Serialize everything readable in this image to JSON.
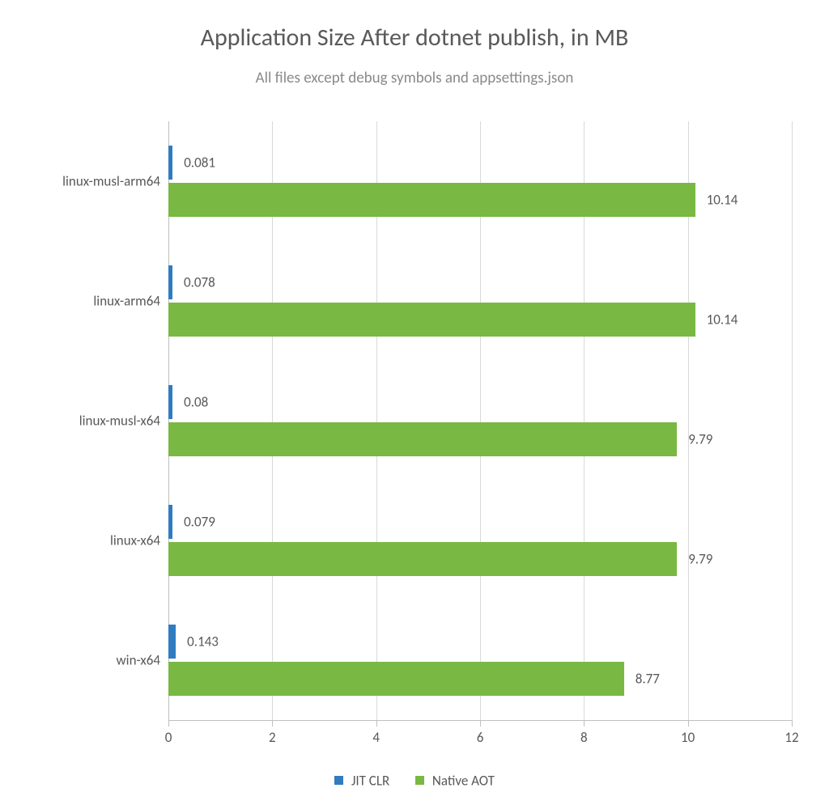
{
  "chart_data": {
    "type": "bar",
    "orientation": "horizontal",
    "title": "Application Size After dotnet publish, in MB",
    "subtitle": "All files except debug symbols and appsettings.json",
    "xlabel": "",
    "ylabel": "",
    "xlim": [
      0,
      12
    ],
    "x_ticks": [
      0,
      2,
      4,
      6,
      8,
      10,
      12
    ],
    "categories": [
      "linux-musl-arm64",
      "linux-arm64",
      "linux-musl-x64",
      "linux-x64",
      "win-x64"
    ],
    "series": [
      {
        "name": "JIT CLR",
        "color": "#2f7cc0",
        "values": [
          0.081,
          0.078,
          0.08,
          0.079,
          0.143
        ]
      },
      {
        "name": "Native AOT",
        "color": "#79b842",
        "values": [
          10.14,
          10.14,
          9.79,
          9.79,
          8.77
        ]
      }
    ],
    "legend_position": "bottom",
    "grid": {
      "x": true,
      "y": false
    }
  }
}
